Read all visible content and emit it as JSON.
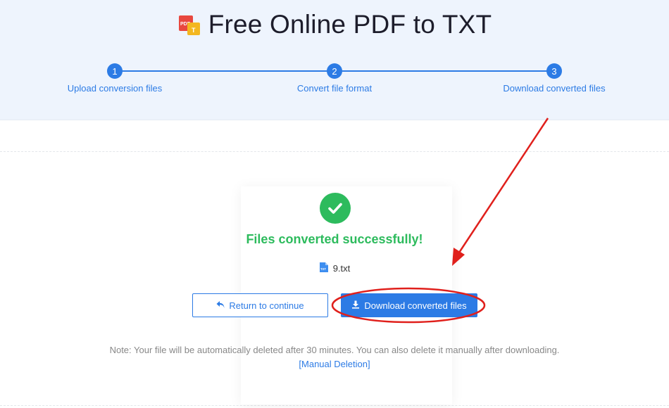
{
  "header": {
    "title": "Free Online PDF to TXT",
    "logo_text_top": "PDF",
    "logo_text_bottom": "T"
  },
  "steps": [
    {
      "number": "1",
      "label": "Upload conversion files"
    },
    {
      "number": "2",
      "label": "Convert file format"
    },
    {
      "number": "3",
      "label": "Download converted files"
    }
  ],
  "result": {
    "status_icon": "check-circle-icon",
    "message": "Files converted successfully!",
    "file_icon_text": "TXT",
    "file_name": "9.txt"
  },
  "buttons": {
    "return_label": "Return to continue",
    "download_label": "Download converted files"
  },
  "note": {
    "text": "Note: Your file will be automatically deleted after 30 minutes. You can also delete it manually after downloading.",
    "manual_link": "[Manual Deletion]"
  },
  "colors": {
    "accent": "#2c7be5",
    "success": "#2dbb5d",
    "annotation": "#e0201c",
    "hero_bg": "#eef4fd"
  }
}
